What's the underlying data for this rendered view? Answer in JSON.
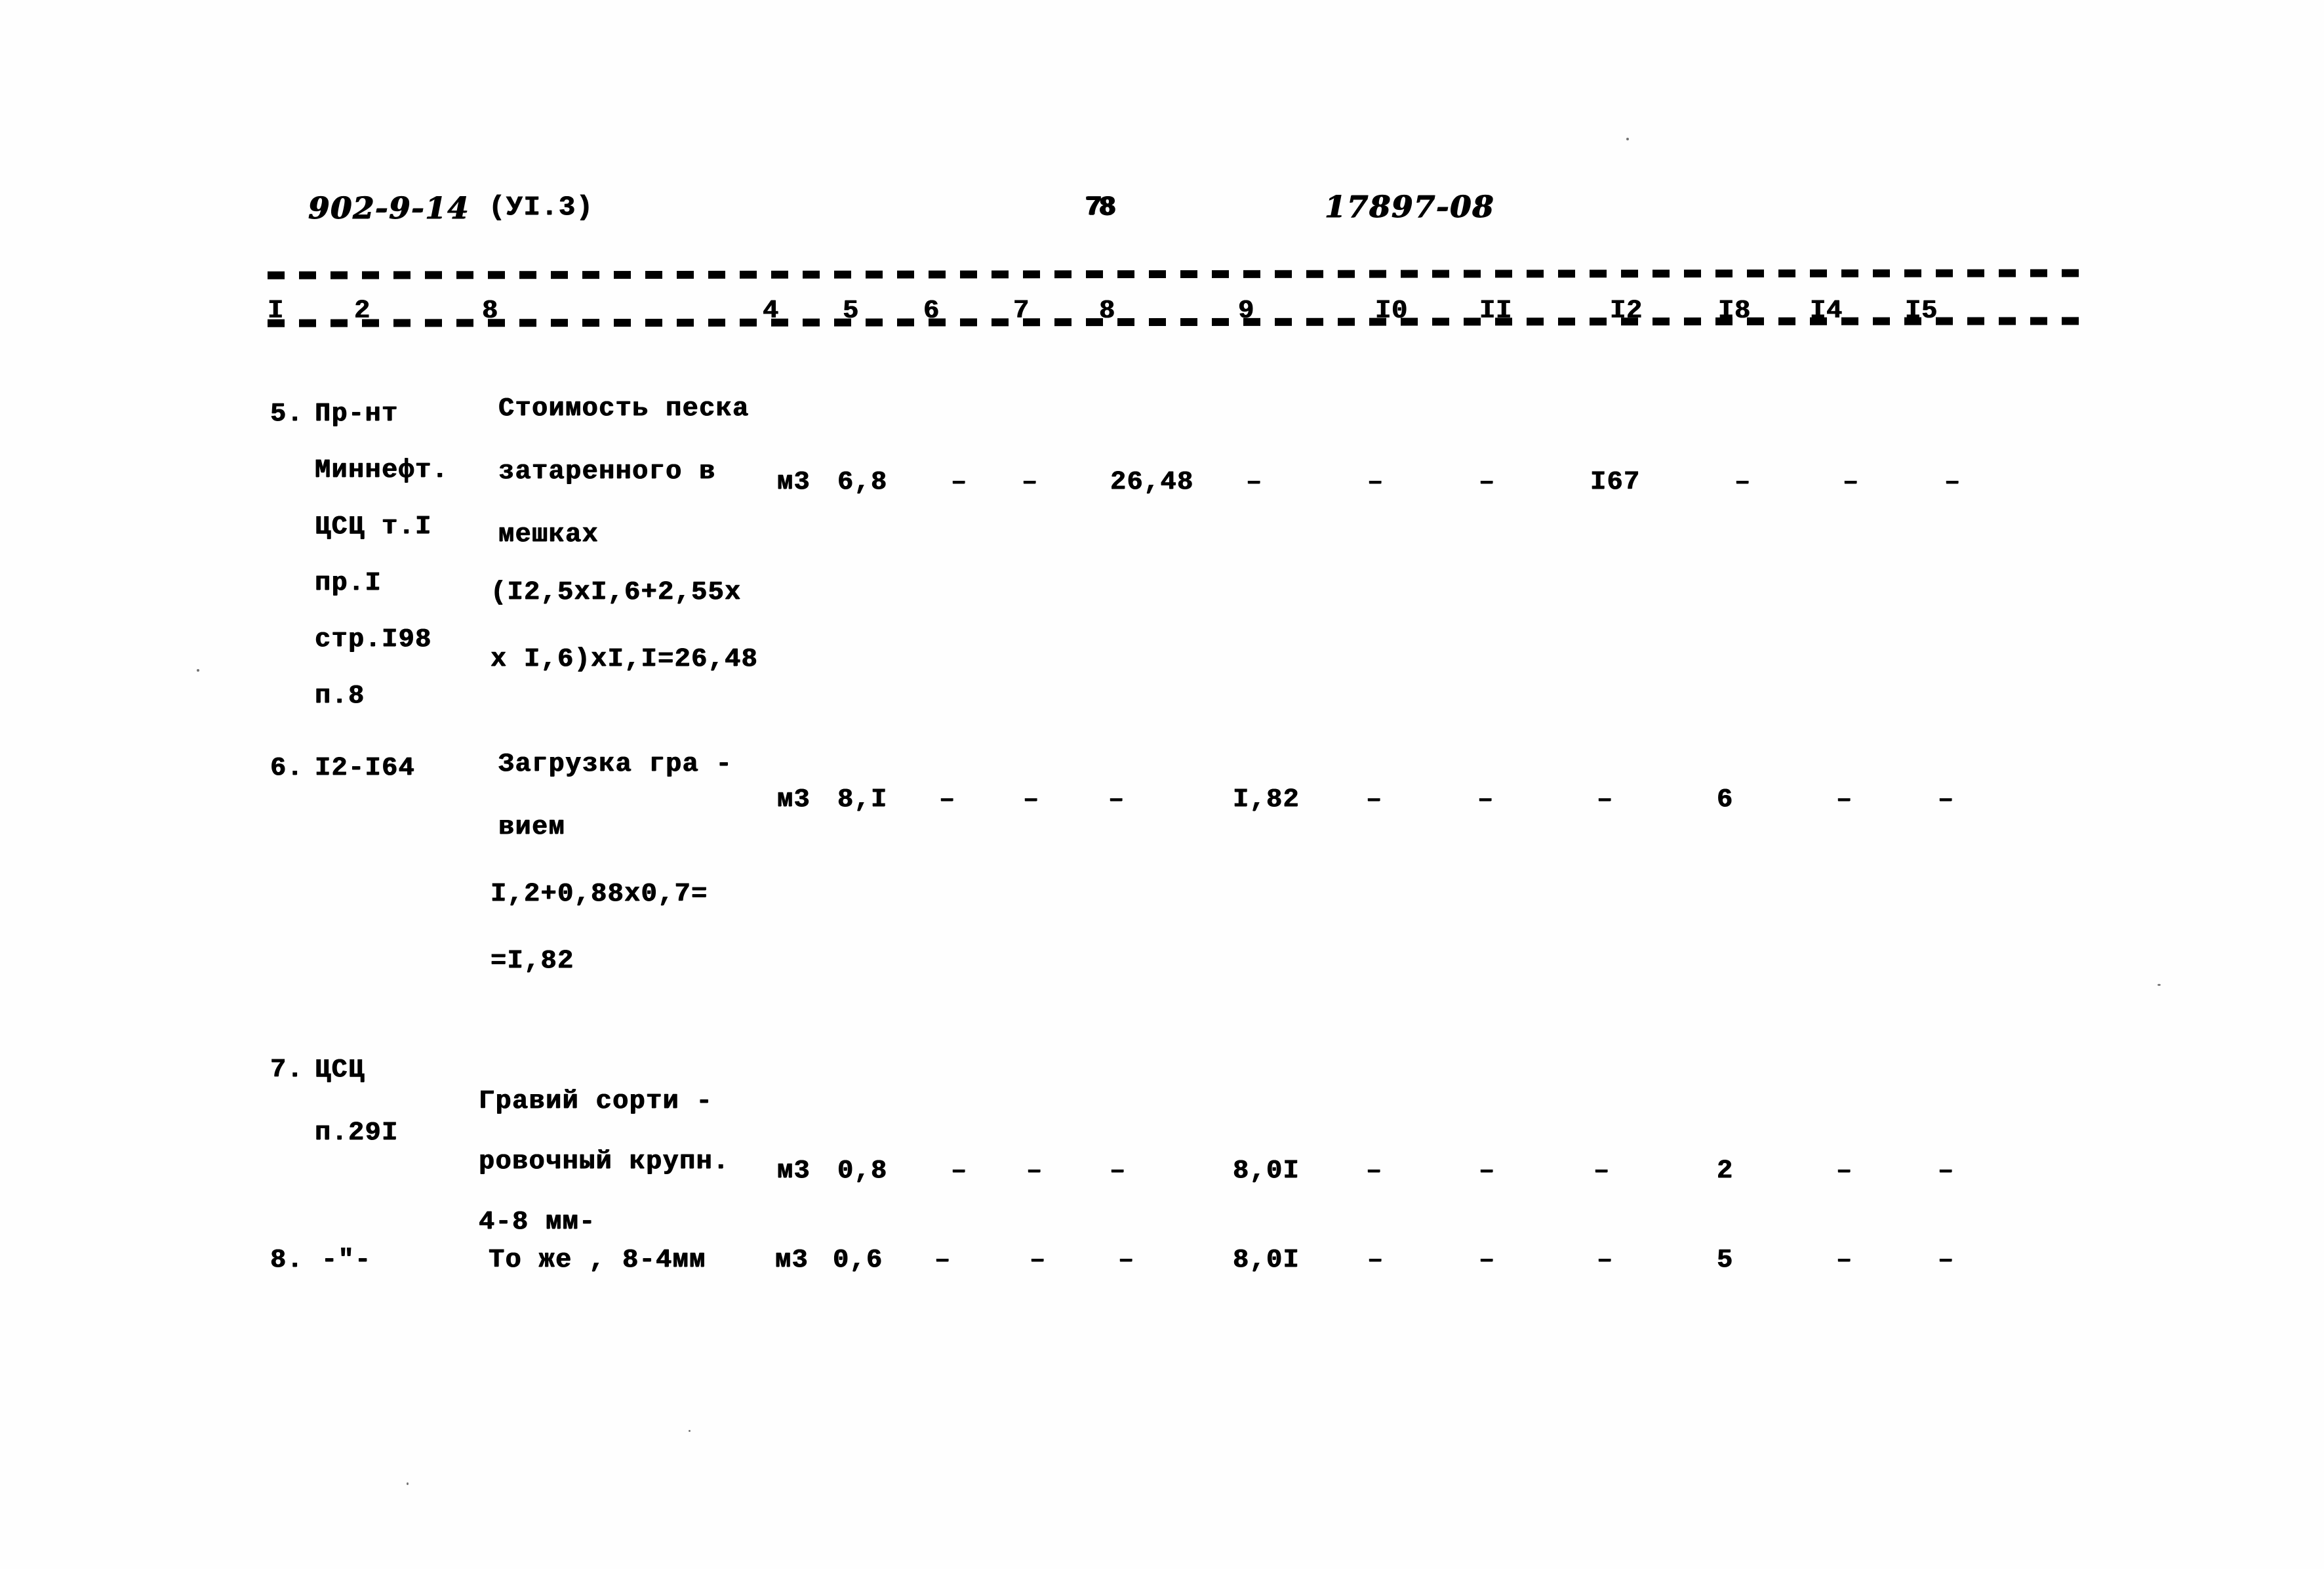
{
  "document": {
    "series_code": "902-9-14",
    "section_code": "(УI.3)",
    "page_number": "78",
    "archive_code": "17897-08"
  },
  "column_header": {
    "numbers": [
      "I",
      "2",
      "8",
      "4",
      "5",
      "6",
      "7",
      "8",
      "9",
      "I0",
      "II",
      "I2",
      "I8",
      "I4",
      "I5"
    ]
  },
  "rows": [
    {
      "index": "5.",
      "ref_lines": [
        "Пр-нт",
        "Миннефт.",
        "ЦСЦ т.I",
        "пр.I",
        "стр.I98",
        "п.8"
      ],
      "description_lines": [
        "Стоимость песка",
        "затаренного в",
        "мешках"
      ],
      "unit": "м3",
      "values": [
        "6,8",
        "–",
        "–",
        "26,48",
        "–",
        "–",
        "–",
        "I67",
        "–",
        "–",
        "–"
      ],
      "calc_lines": [
        "(I2,5xI,6+2,55x",
        "x I,6)xI,I=26,48"
      ]
    },
    {
      "index": "6.",
      "ref_lines": [
        "I2-I64"
      ],
      "description_lines": [
        "Загрузка гра -",
        "вием"
      ],
      "unit": "м3",
      "values": [
        "8,I",
        "–",
        "–",
        "–",
        "I,82",
        "–",
        "–",
        "–",
        "6",
        "–",
        "–"
      ],
      "calc_lines": [
        "I,2+0,88x0,7=",
        "=I,82"
      ]
    },
    {
      "index": "7.",
      "ref_lines": [
        "ЦСЦ",
        "п.29I"
      ],
      "description_lines": [
        "Гравий сорти -",
        "ровочный крупн.",
        "4-8 мм-"
      ],
      "unit": "м3",
      "values": [
        "0,8",
        "–",
        "–",
        "–",
        "8,0I",
        "–",
        "–",
        "–",
        "2",
        "–",
        "–"
      ],
      "calc_lines": []
    },
    {
      "index": "8.",
      "ref_lines": [
        "-\"-"
      ],
      "description_lines": [
        "То же , 8-4мм"
      ],
      "unit": "м3",
      "values": [
        "0,6",
        "–",
        "–",
        "–",
        "8,0I",
        "–",
        "–",
        "–",
        "5",
        "–",
        "–"
      ],
      "calc_lines": []
    }
  ]
}
